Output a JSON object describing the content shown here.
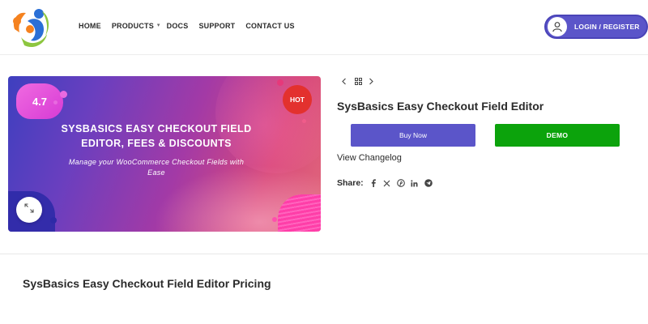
{
  "header": {
    "nav": [
      {
        "label": "HOME",
        "has_dropdown": false
      },
      {
        "label": "PRODUCTS",
        "has_dropdown": true
      },
      {
        "label": "DOCS",
        "has_dropdown": false
      },
      {
        "label": "SUPPORT",
        "has_dropdown": false
      },
      {
        "label": "CONTACT US",
        "has_dropdown": false
      }
    ],
    "login_label": "LOGIN / REGISTER",
    "login_icon": "user-icon",
    "colors": {
      "login_bg": "#5b55c9"
    }
  },
  "product_image": {
    "rating": "4.7",
    "badge": "HOT",
    "title": "SYSBASICS EASY CHECKOUT FIELD EDITOR, FEES & DISCOUNTS",
    "subtitle": "Manage your WooCommerce Checkout Fields with Ease",
    "zoom_icon": "expand-icon"
  },
  "product": {
    "title": "SysBasics Easy Checkout Field Editor",
    "buy_label": "Buy Now",
    "demo_label": "DEMO",
    "changelog_label": "View Changelog",
    "share_label": "Share:",
    "share_icons": [
      "facebook-icon",
      "x-icon",
      "pinterest-icon",
      "linkedin-icon",
      "telegram-icon"
    ],
    "colors": {
      "buy": "#5b55c9",
      "demo": "#0ca30c",
      "hot": "#e3312e"
    }
  },
  "pricing": {
    "title": "SysBasics Easy Checkout Field Editor Pricing"
  }
}
